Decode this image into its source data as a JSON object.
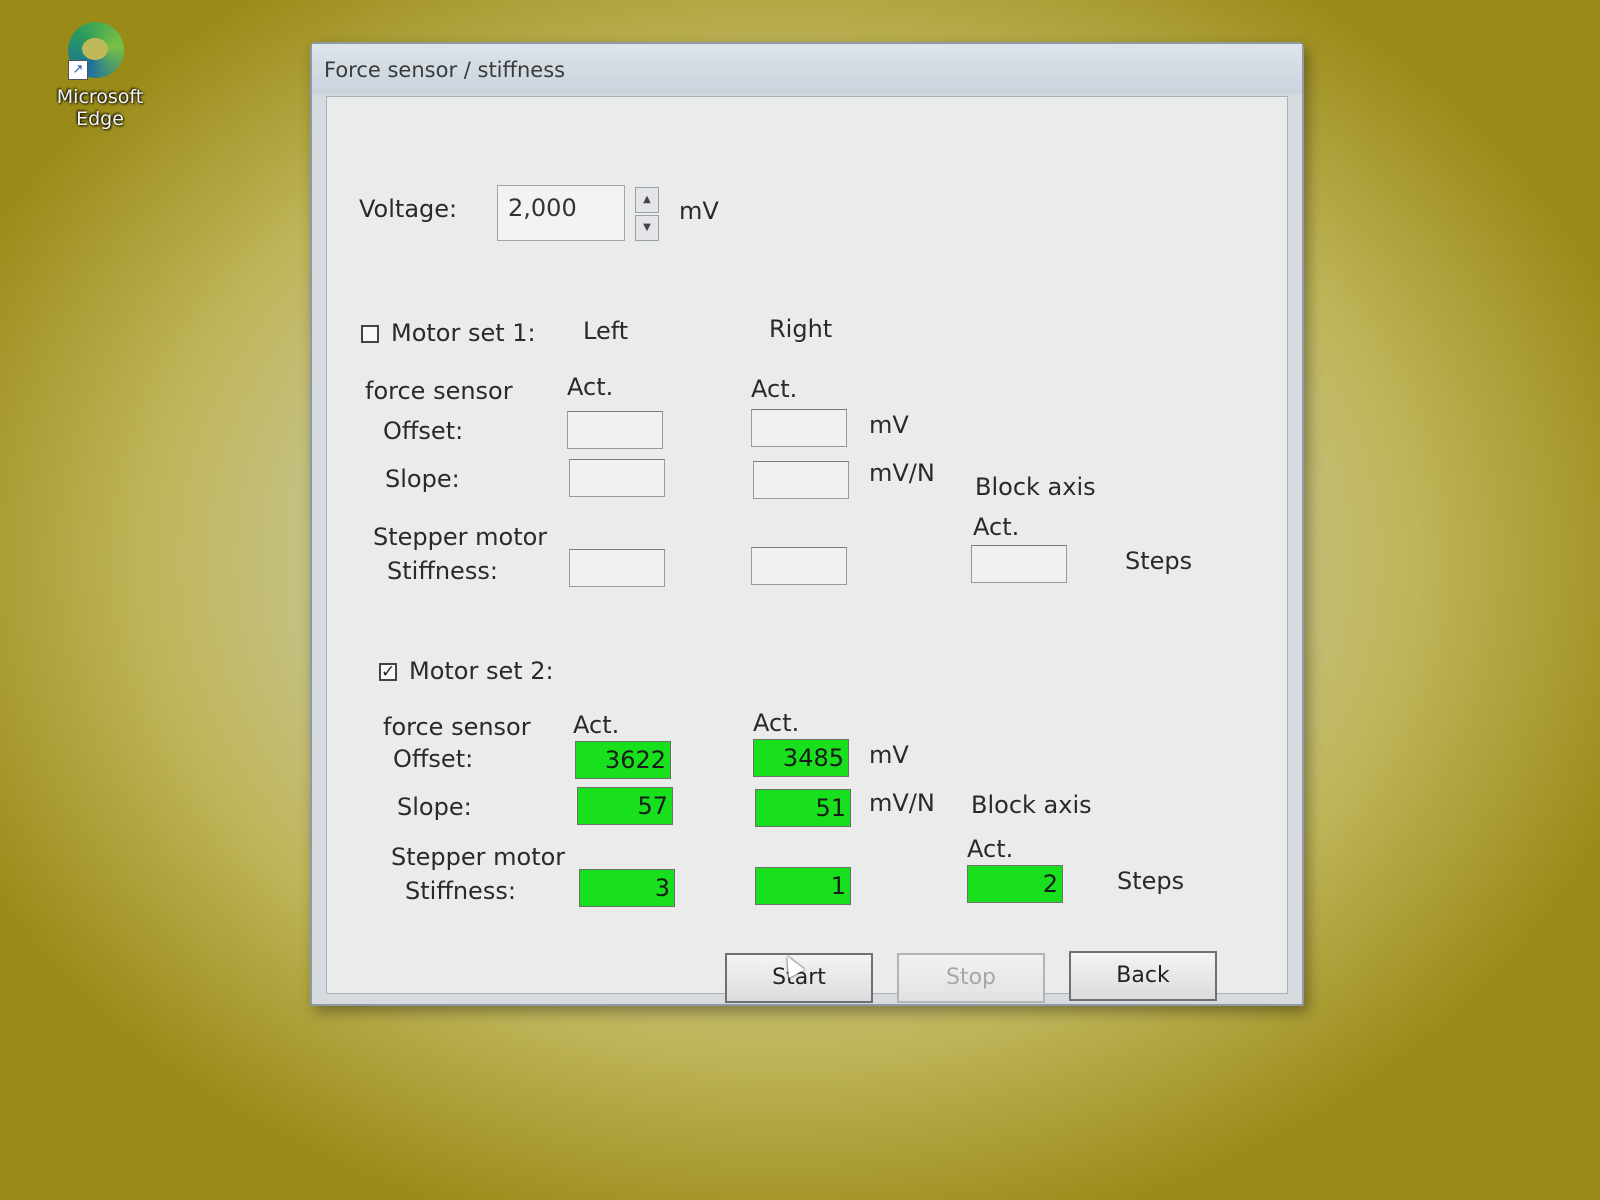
{
  "desktop": {
    "icon_label": "Microsoft Edge",
    "icon": "edge-browser-icon"
  },
  "window": {
    "title": "Force sensor / stiffness"
  },
  "voltage": {
    "label": "Voltage:",
    "value": "2,000",
    "unit": "mV"
  },
  "motor_set_1": {
    "label": "Motor set 1:",
    "checked": false,
    "col_left": "Left",
    "col_right": "Right",
    "force_sensor_label": "force sensor",
    "act_left": "Act.",
    "act_right": "Act.",
    "offset_label": "Offset:",
    "offset_unit": "mV",
    "slope_label": "Slope:",
    "slope_unit": "mV/N",
    "block_axis_label": "Block axis",
    "block_act": "Act.",
    "stepper_label": "Stepper motor",
    "stiffness_label": "Stiffness:",
    "steps_unit": "Steps",
    "offset_left": "",
    "offset_right": "",
    "slope_left": "",
    "slope_right": "",
    "stiffness_left": "",
    "stiffness_right": "",
    "block_axis_value": ""
  },
  "motor_set_2": {
    "label": "Motor set 2:",
    "checked": true,
    "force_sensor_label": "force sensor",
    "act_left": "Act.",
    "act_right": "Act.",
    "offset_label": "Offset:",
    "offset_unit": "mV",
    "slope_label": "Slope:",
    "slope_unit": "mV/N",
    "block_axis_label": "Block axis",
    "block_act": "Act.",
    "stepper_label": "Stepper motor",
    "stiffness_label": "Stiffness:",
    "steps_unit": "Steps",
    "offset_left": "3622",
    "offset_right": "3485",
    "slope_left": "57",
    "slope_right": "51",
    "stiffness_left": "3",
    "stiffness_right": "1",
    "block_axis_value": "2"
  },
  "buttons": {
    "start": "Start",
    "stop": "Stop",
    "back": "Back"
  },
  "colors": {
    "active_field": "#19e01c"
  }
}
